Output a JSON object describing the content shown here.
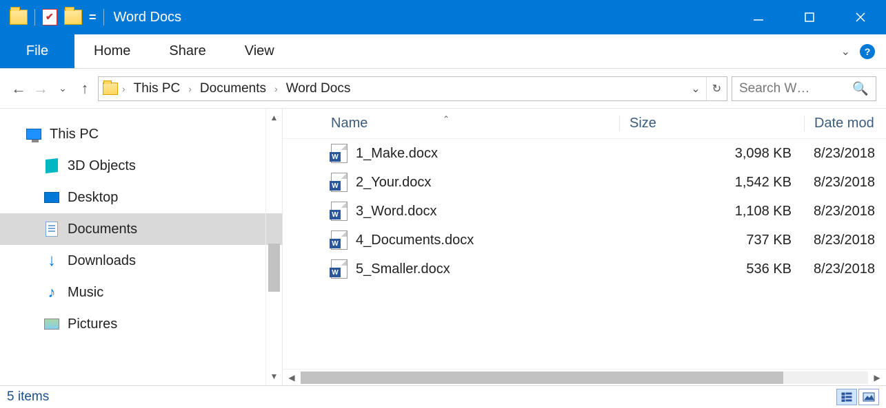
{
  "title": "Word Docs",
  "ribbon": {
    "file": "File",
    "tabs": [
      "Home",
      "Share",
      "View"
    ]
  },
  "breadcrumbs": [
    "This PC",
    "Documents",
    "Word Docs"
  ],
  "search_placeholder": "Search W…",
  "sidebar": {
    "root": "This PC",
    "items": [
      {
        "label": "3D Objects",
        "icon": "3d"
      },
      {
        "label": "Desktop",
        "icon": "desktop"
      },
      {
        "label": "Documents",
        "icon": "doc",
        "selected": true
      },
      {
        "label": "Downloads",
        "icon": "down"
      },
      {
        "label": "Music",
        "icon": "music"
      },
      {
        "label": "Pictures",
        "icon": "pic"
      }
    ]
  },
  "columns": {
    "name": "Name",
    "size": "Size",
    "date": "Date mod"
  },
  "files": [
    {
      "name": "1_Make.docx",
      "size": "3,098 KB",
      "date": "8/23/2018"
    },
    {
      "name": "2_Your.docx",
      "size": "1,542 KB",
      "date": "8/23/2018"
    },
    {
      "name": "3_Word.docx",
      "size": "1,108 KB",
      "date": "8/23/2018"
    },
    {
      "name": "4_Documents.docx",
      "size": "737 KB",
      "date": "8/23/2018"
    },
    {
      "name": "5_Smaller.docx",
      "size": "536 KB",
      "date": "8/23/2018"
    }
  ],
  "status": "5 items"
}
